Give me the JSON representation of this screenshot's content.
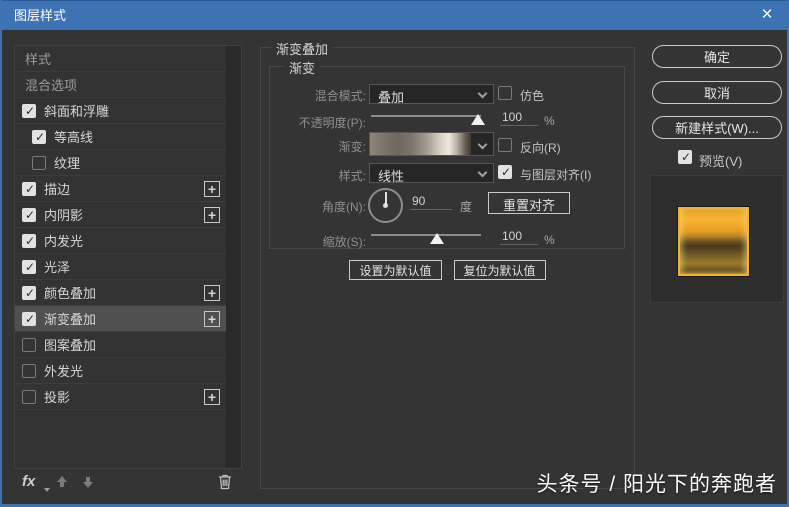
{
  "window": {
    "title": "图层样式"
  },
  "sidebar": {
    "items": [
      {
        "key": "styles",
        "label": "样式",
        "checkbox": null,
        "plus": false,
        "indent": 0,
        "selected": false,
        "dim": true
      },
      {
        "key": "blending-options",
        "label": "混合选项",
        "checkbox": null,
        "plus": false,
        "indent": 0,
        "selected": false,
        "dim": true
      },
      {
        "key": "bevel-emboss",
        "label": "斜面和浮雕",
        "checkbox": true,
        "plus": false,
        "indent": 0,
        "selected": false
      },
      {
        "key": "contour",
        "label": "等高线",
        "checkbox": true,
        "plus": false,
        "indent": 1,
        "selected": false
      },
      {
        "key": "texture",
        "label": "纹理",
        "checkbox": false,
        "plus": false,
        "indent": 1,
        "selected": false
      },
      {
        "key": "stroke",
        "label": "描边",
        "checkbox": true,
        "plus": true,
        "indent": 0,
        "selected": false
      },
      {
        "key": "inner-shadow",
        "label": "内阴影",
        "checkbox": true,
        "plus": true,
        "indent": 0,
        "selected": false
      },
      {
        "key": "inner-glow",
        "label": "内发光",
        "checkbox": true,
        "plus": false,
        "indent": 0,
        "selected": false
      },
      {
        "key": "satin",
        "label": "光泽",
        "checkbox": true,
        "plus": false,
        "indent": 0,
        "selected": false
      },
      {
        "key": "color-overlay",
        "label": "颜色叠加",
        "checkbox": true,
        "plus": true,
        "indent": 0,
        "selected": false
      },
      {
        "key": "gradient-overlay",
        "label": "渐变叠加",
        "checkbox": true,
        "plus": true,
        "indent": 0,
        "selected": true
      },
      {
        "key": "pattern-overlay",
        "label": "图案叠加",
        "checkbox": false,
        "plus": false,
        "indent": 0,
        "selected": false
      },
      {
        "key": "outer-glow",
        "label": "外发光",
        "checkbox": false,
        "plus": false,
        "indent": 0,
        "selected": false
      },
      {
        "key": "drop-shadow",
        "label": "投影",
        "checkbox": false,
        "plus": true,
        "indent": 0,
        "selected": false
      }
    ],
    "footer": {
      "fx_label": "fx"
    }
  },
  "main": {
    "group_title": "渐变叠加",
    "subgroup_title": "渐变",
    "blend_mode": {
      "label": "混合模式:",
      "value": "叠加",
      "dither_label": "仿色",
      "dither_checked": false
    },
    "opacity": {
      "label": "不透明度(P):",
      "value": "100",
      "unit": "%"
    },
    "gradient": {
      "label": "渐变:",
      "reverse_label": "反向(R)",
      "reverse_checked": false
    },
    "style": {
      "label": "样式:",
      "value": "线性",
      "align_label": "与图层对齐(I)",
      "align_checked": true
    },
    "angle": {
      "label": "角度(N):",
      "value": "90",
      "unit": "度",
      "reset_button": "重置对齐"
    },
    "scale": {
      "label": "缩放(S):",
      "value": "100",
      "unit": "%"
    },
    "buttons": {
      "set_default": "设置为默认值",
      "reset_default": "复位为默认值"
    }
  },
  "actions": {
    "ok": "确定",
    "cancel": "取消",
    "new_style": "新建样式(W)...",
    "preview_label": "预览(V)",
    "preview_checked": true
  },
  "colors": {
    "titlebar": "#3d73b2",
    "dialog_bg": "#343434",
    "gold_border": "#f0b42d"
  },
  "watermark": "头条号 / 阳光下的奔跑者"
}
